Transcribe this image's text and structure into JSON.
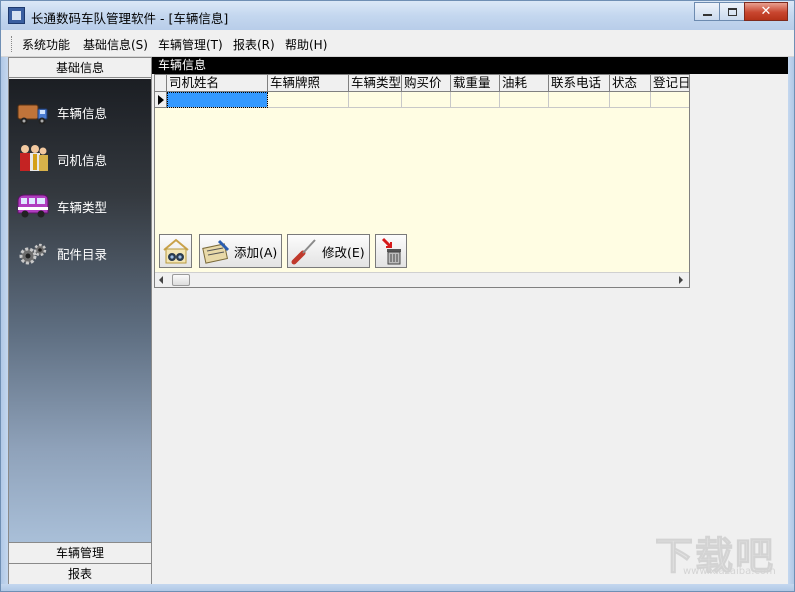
{
  "window": {
    "title": "长通数码车队管理软件 - [车辆信息]",
    "controls": [
      "minimize-icon",
      "maximize-icon",
      "close-icon"
    ],
    "close_glyph": "✕"
  },
  "menu": {
    "items": [
      {
        "label": "系统功能"
      },
      {
        "label": "基础信息(S)"
      },
      {
        "label": "车辆管理(T)"
      },
      {
        "label": "报表(R)"
      },
      {
        "label": "帮助(H)"
      }
    ]
  },
  "nav": {
    "header": "基础信息",
    "items": [
      {
        "label": "车辆信息",
        "icon": "truck-icon"
      },
      {
        "label": "司机信息",
        "icon": "drivers-icon"
      },
      {
        "label": "车辆类型",
        "icon": "bus-icon"
      },
      {
        "label": "配件目录",
        "icon": "gears-icon"
      }
    ],
    "footer": [
      "车辆管理",
      "报表"
    ]
  },
  "main": {
    "section_title": "车辆信息",
    "table": {
      "columns": [
        "司机姓名",
        "车辆牌照",
        "车辆类型",
        "购买价",
        "载重量",
        "油耗",
        "联系电话",
        "状态",
        "登记日"
      ],
      "rows": [
        [
          "",
          "",
          "",
          "",
          "",
          "",
          "",
          "",
          ""
        ]
      ]
    },
    "toolbar": {
      "search_icon": "binoculars-icon",
      "add_label": "添加(A)",
      "add_icon": "edit-form-icon",
      "edit_label": "修改(E)",
      "edit_icon": "screwdriver-icon",
      "delete_icon": "trash-icon"
    }
  },
  "watermark": {
    "main": "下载吧",
    "sub": "www.xiazaiba.com"
  },
  "colors": {
    "grid_background": "#fffde3",
    "selection": "#3399ff",
    "section_title_bg": "#000000",
    "nav_gradient_top": "#1b1e23",
    "nav_gradient_bottom": "#a9bfd8"
  }
}
